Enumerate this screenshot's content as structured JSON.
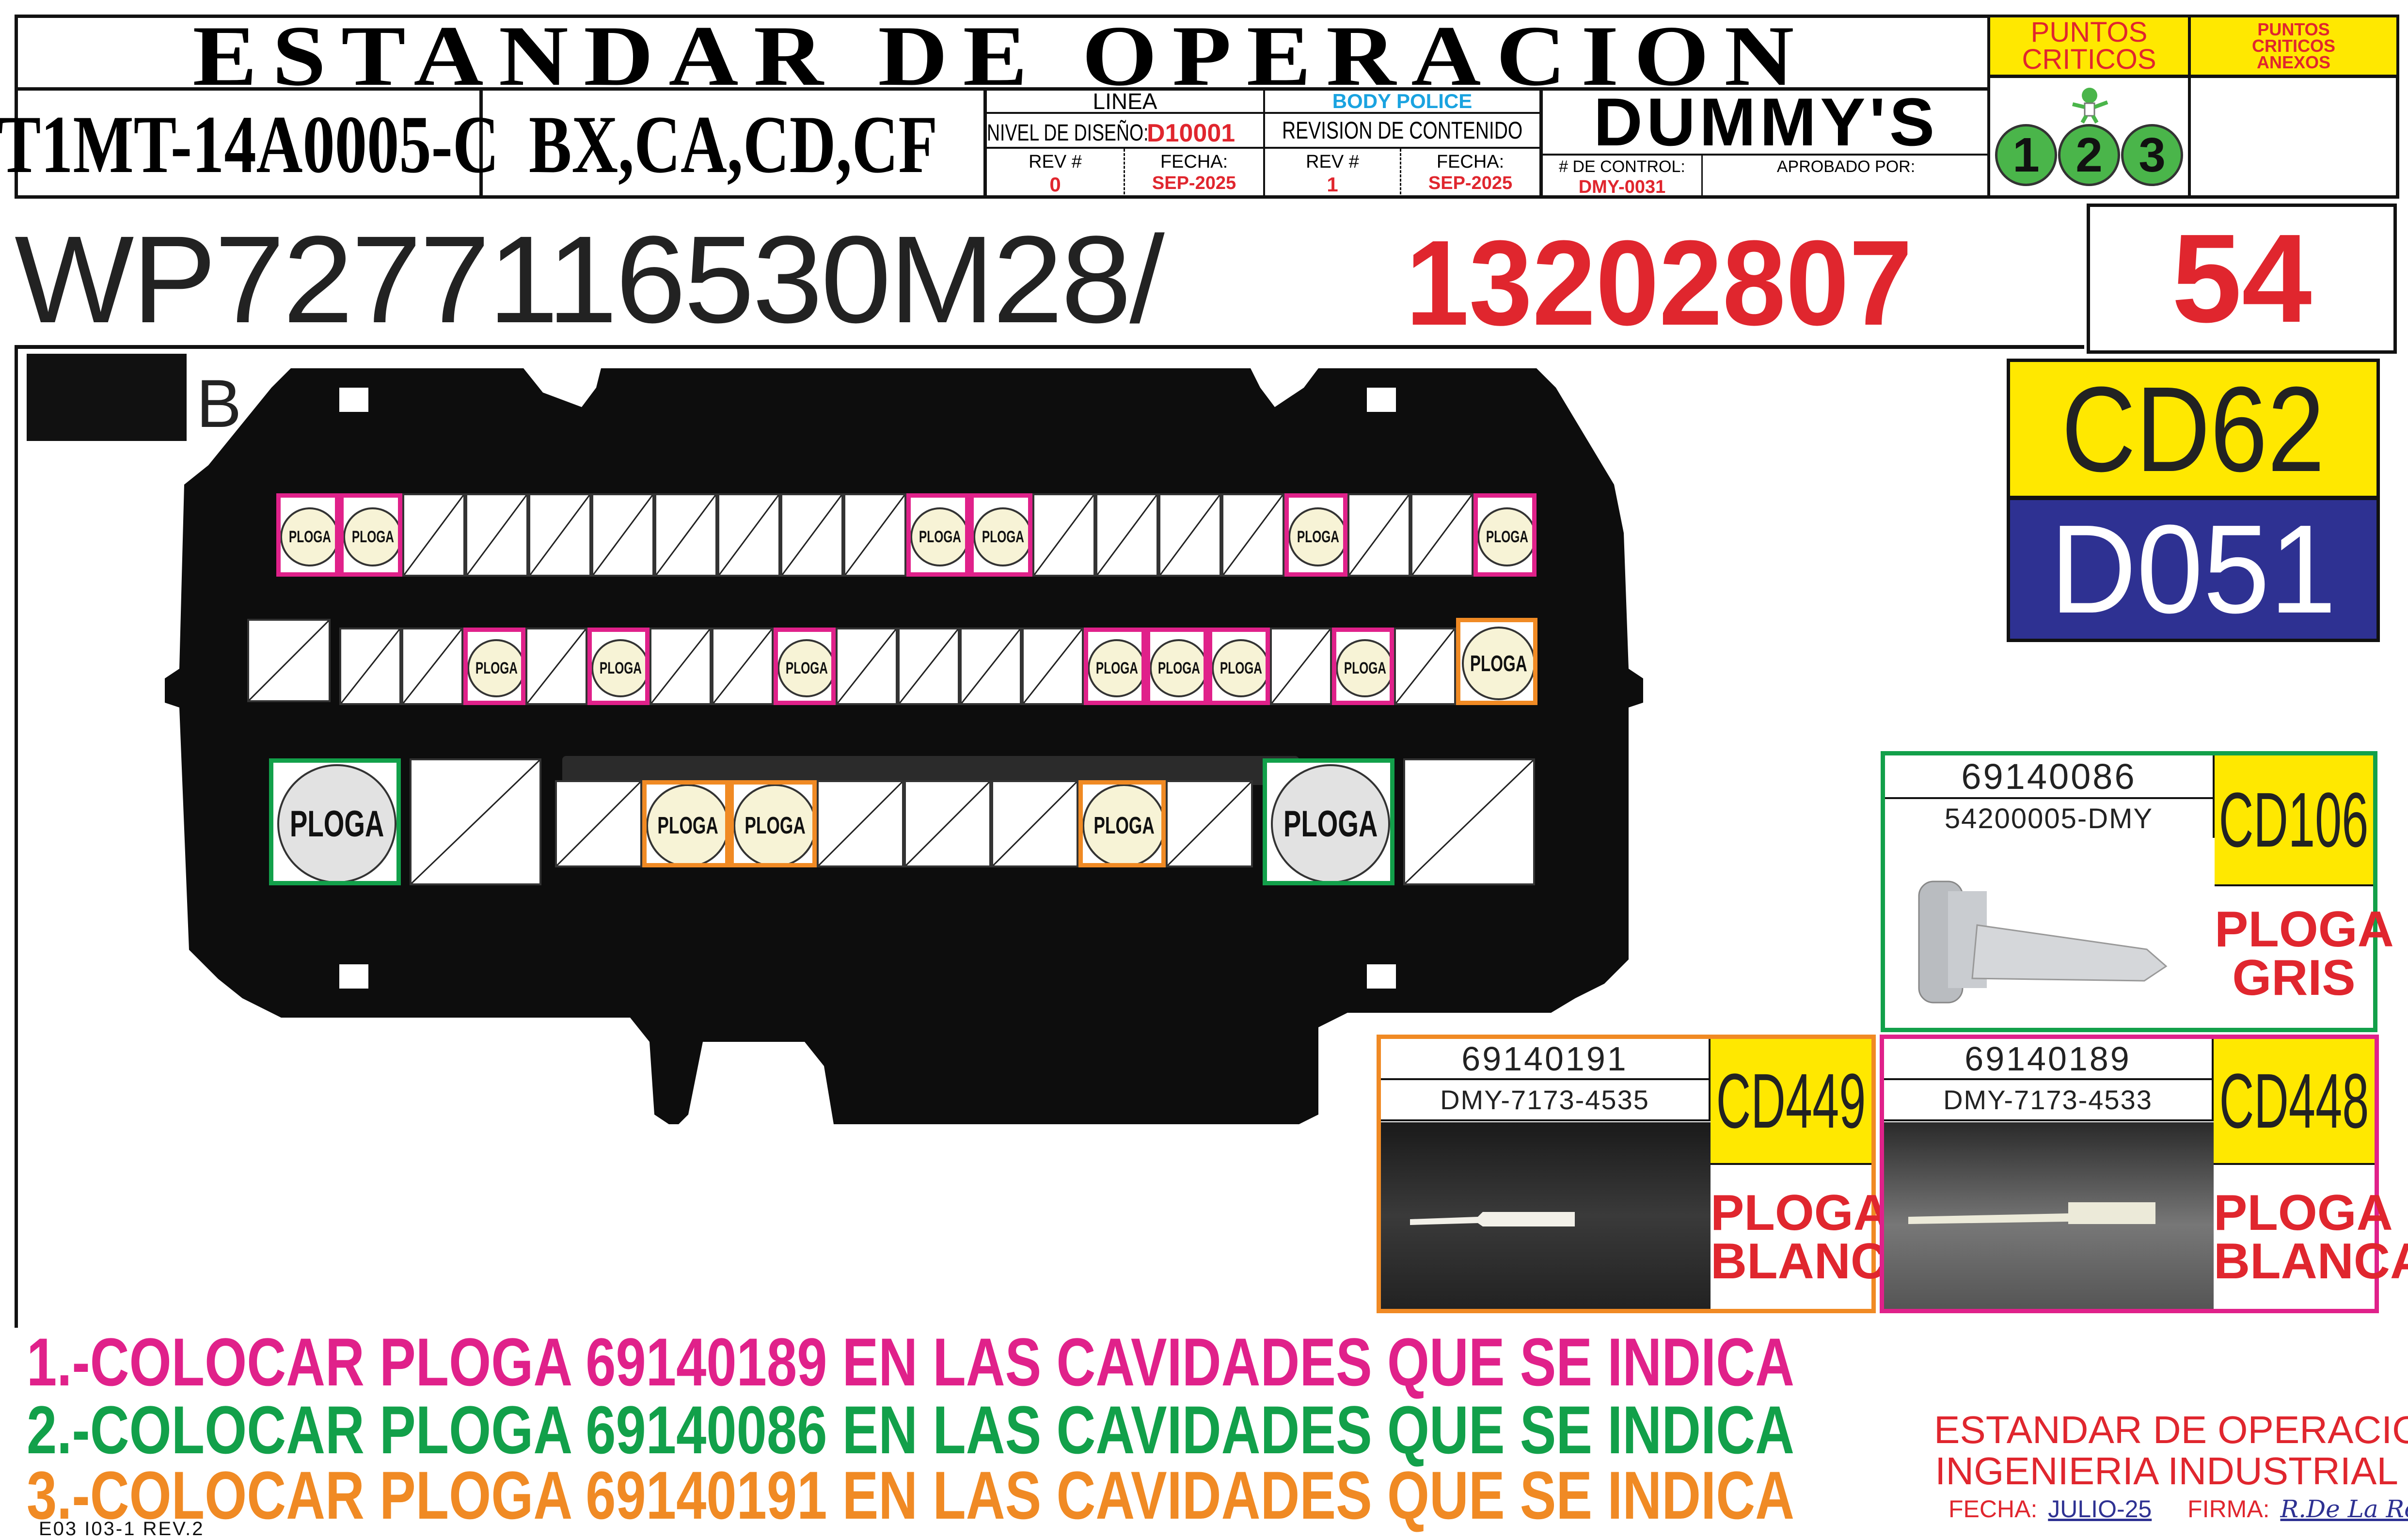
{
  "header": {
    "title": "ESTANDAR DE OPERACION",
    "part_number": "T1MT-14A0005-C",
    "models": "BX,CA,CD,CF",
    "linea_label": "LINEA",
    "linea_value": "BODY POLICE",
    "nivel_label": "NIVEL DE DISEÑO:",
    "nivel_value": "D10001",
    "revision_label": "REVISION DE CONTENIDO",
    "rev1_label": "REV #",
    "rev1_value": "0",
    "fecha1_label": "FECHA:",
    "fecha1_value": "SEP-2025",
    "rev2_label": "REV #",
    "rev2_value": "1",
    "fecha2_label": "FECHA:",
    "fecha2_value": "SEP-2025",
    "dummys": "DUMMY'S",
    "control_label": "# DE CONTROL:",
    "control_value": "DMY-0031",
    "aprobado_label": "APROBADO POR:",
    "puntos_criticos": "PUNTOS CRITICOS",
    "puntos_criticos_anexos": "PUNTOS CRITICOS ANEXOS",
    "critical_levels": [
      "1",
      "2",
      "3"
    ]
  },
  "main": {
    "code_prefix": "WP7277116530M28/",
    "code_red": "13202807",
    "number": "54",
    "cd_code": "CD62",
    "d_code": "D051",
    "connector_view": "B",
    "cavity_label": "PLOGA"
  },
  "cavities": {
    "row1": [
      "pk",
      "pk",
      "e",
      "e",
      "e",
      "e",
      "e",
      "e",
      "e",
      "e",
      "pk",
      "pk",
      "e",
      "e",
      "e",
      "e",
      "pk",
      "e",
      "e",
      "pk"
    ],
    "row2": [
      "e",
      "e",
      "e",
      "pk",
      "e",
      "pk",
      "e",
      "e",
      "pk",
      "e",
      "e",
      "e",
      "e",
      "pk",
      "pk",
      "pk",
      "e",
      "pk",
      "e",
      "or"
    ],
    "row3": [
      "gr",
      "e",
      "e",
      "or",
      "or",
      "e",
      "e",
      "e",
      "or",
      "e",
      "gr",
      "e"
    ]
  },
  "parts": [
    {
      "code": "69140086",
      "sub": "54200005-DMY",
      "cd": "CD106",
      "desc_line1": "PLOGA",
      "desc_line2": "GRIS",
      "color": "#12a04a"
    },
    {
      "code": "69140191",
      "sub": "DMY-7173-4535",
      "cd": "CD449",
      "desc_line1": "PLOGA",
      "desc_line2": "BLANCA",
      "color": "#f08a24"
    },
    {
      "code": "69140189",
      "sub": "DMY-7173-4533",
      "cd": "CD448",
      "desc_line1": "PLOGA",
      "desc_line2": "BLANCA",
      "color": "#e0218a"
    }
  ],
  "instructions": [
    {
      "text": "1.-COLOCAR PLOGA 69140189 EN LAS CAVIDADES QUE SE INDICA",
      "color": "#e0218a"
    },
    {
      "text": "2.-COLOCAR PLOGA 69140086 EN LAS CAVIDADES QUE SE INDICA",
      "color": "#12a04a"
    },
    {
      "text": "3.-COLOCAR PLOGA 69140191 EN LAS CAVIDADES QUE SE INDICA",
      "color": "#f08a24"
    }
  ],
  "footer": {
    "line1": "ESTANDAR DE OPERACION",
    "line2": "INGENIERIA INDUSTRIAL",
    "fecha_label": "FECHA:",
    "fecha_value": "JULIO-25",
    "firma_label": "FIRMA:",
    "firma_value": "R.De La Rosa",
    "doc_id": "E03 I03-1  REV.2"
  },
  "colors": {
    "pink": "#e0218a",
    "green": "#12a04a",
    "orange": "#f08a24",
    "red": "#e0262e",
    "yellow": "#ffe800",
    "navy": "#2e3192"
  }
}
